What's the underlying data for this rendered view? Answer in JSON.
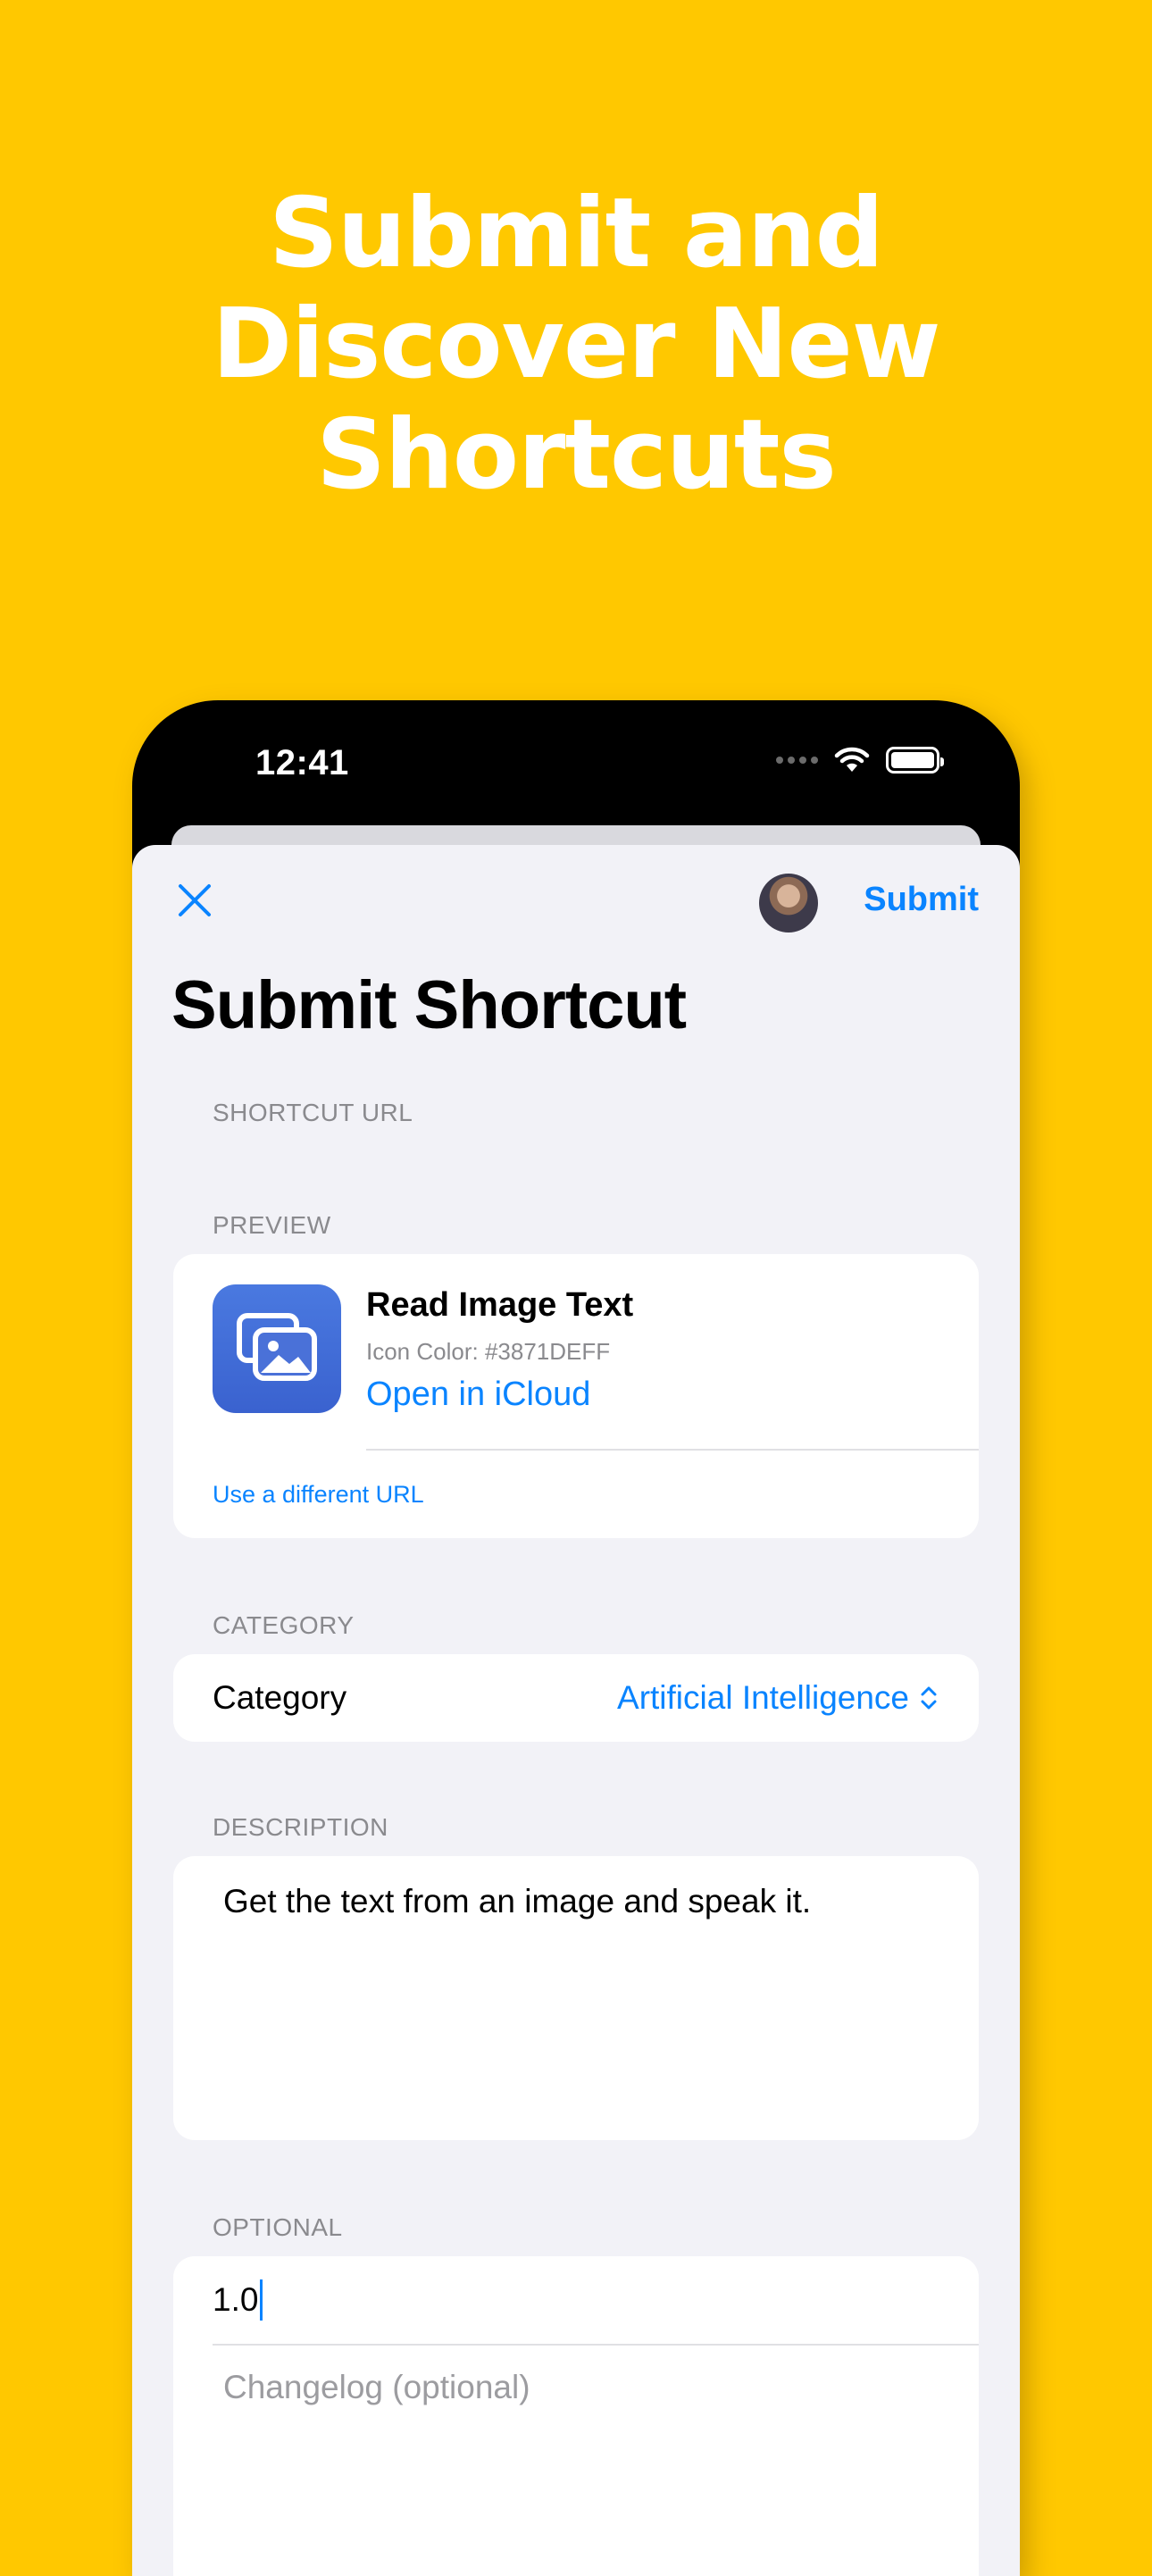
{
  "promo": {
    "headline_lines": [
      "Submit and",
      "Discover New",
      "Shortcuts"
    ]
  },
  "status_bar": {
    "time": "12:41"
  },
  "nav": {
    "close_icon": "close-icon",
    "submit_label": "Submit"
  },
  "page": {
    "title": "Submit Shortcut"
  },
  "sections": {
    "shortcut_url": "SHORTCUT URL",
    "preview": "PREVIEW",
    "category": "CATEGORY",
    "description": "DESCRIPTION",
    "optional": "OPTIONAL"
  },
  "preview": {
    "name": "Read Image Text",
    "icon_color": "Icon Color: #3871DEFF",
    "open_label": "Open in iCloud",
    "different_url_label": "Use a different URL",
    "icon": "photos-icon"
  },
  "category": {
    "label": "Category",
    "value": "Artificial Intelligence"
  },
  "description": {
    "value": "Get the text from an image and speak it."
  },
  "optional": {
    "version_value": "1.0",
    "changelog_placeholder": "Changelog (optional)"
  },
  "colors": {
    "background": "#FFC800",
    "accent": "#0A84FF",
    "sheet": "#F2F2F7",
    "shortcut_icon": "#3871DE"
  }
}
